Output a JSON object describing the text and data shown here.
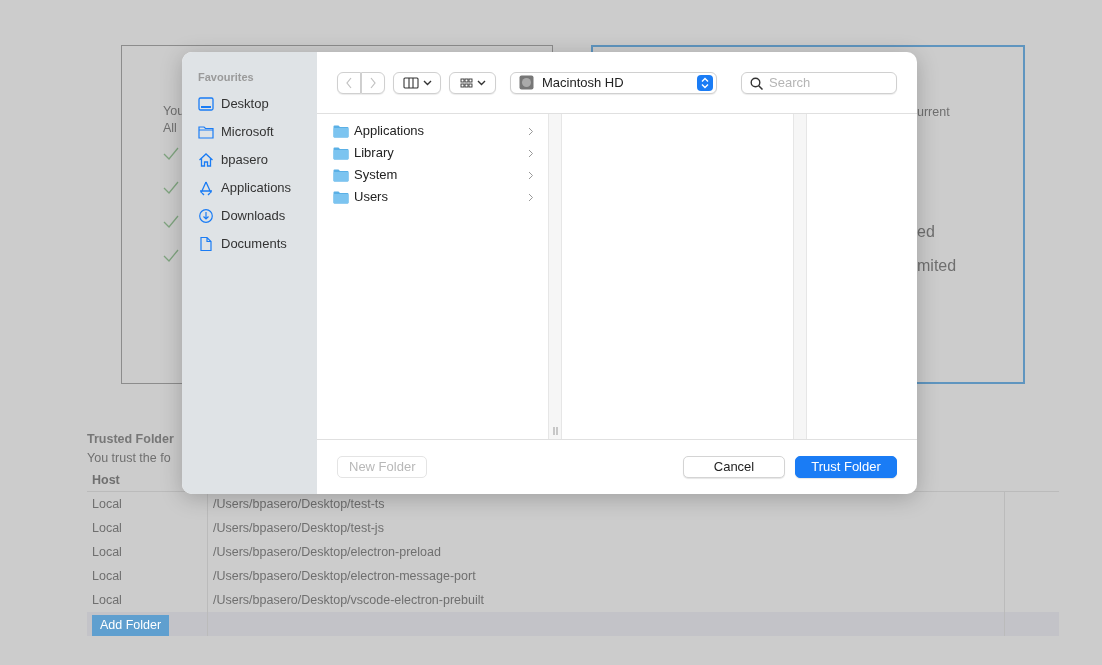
{
  "background": {
    "cards": [
      {
        "selected": false,
        "lines": [
          "You",
          "All"
        ],
        "checks": [
          {
            "checked": true
          },
          {
            "checked": true
          },
          {
            "checked": true
          },
          {
            "checked": true
          }
        ]
      },
      {
        "selected": true,
        "lines": [
          "urrent",
          "ed",
          "mited"
        ]
      }
    ],
    "trusted_folders": {
      "title": "Trusted Folder",
      "description": "You trust the fo",
      "columns": [
        "Host"
      ],
      "rows": [
        {
          "host": "Local",
          "path": "/Users/bpasero/Desktop/test-ts"
        },
        {
          "host": "Local",
          "path": "/Users/bpasero/Desktop/test-js"
        },
        {
          "host": "Local",
          "path": "/Users/bpasero/Desktop/electron-preload"
        },
        {
          "host": "Local",
          "path": "/Users/bpasero/Desktop/electron-message-port"
        },
        {
          "host": "Local",
          "path": "/Users/bpasero/Desktop/vscode-electron-prebuilt"
        }
      ],
      "add_button": "Add Folder"
    }
  },
  "dialog": {
    "sidebar": {
      "heading": "Favourites",
      "items": [
        {
          "label": "Desktop",
          "kind": "desktop"
        },
        {
          "label": "Microsoft",
          "kind": "folder"
        },
        {
          "label": "bpasero",
          "kind": "home"
        },
        {
          "label": "Applications",
          "kind": "apps"
        },
        {
          "label": "Downloads",
          "kind": "downloads"
        },
        {
          "label": "Documents",
          "kind": "document"
        }
      ]
    },
    "toolbar": {
      "back_disabled": true,
      "forward_disabled": true,
      "location": "Macintosh HD",
      "search": {
        "placeholder": "Search"
      }
    },
    "files": [
      {
        "name": "Applications"
      },
      {
        "name": "Library"
      },
      {
        "name": "System"
      },
      {
        "name": "Users"
      }
    ],
    "buttons": [
      {
        "label": "New Folder",
        "kind": "plain",
        "disabled": true
      },
      {
        "label": "Cancel",
        "kind": "plain",
        "disabled": false
      },
      {
        "label": "Trust Folder",
        "kind": "primary",
        "disabled": false
      }
    ]
  }
}
